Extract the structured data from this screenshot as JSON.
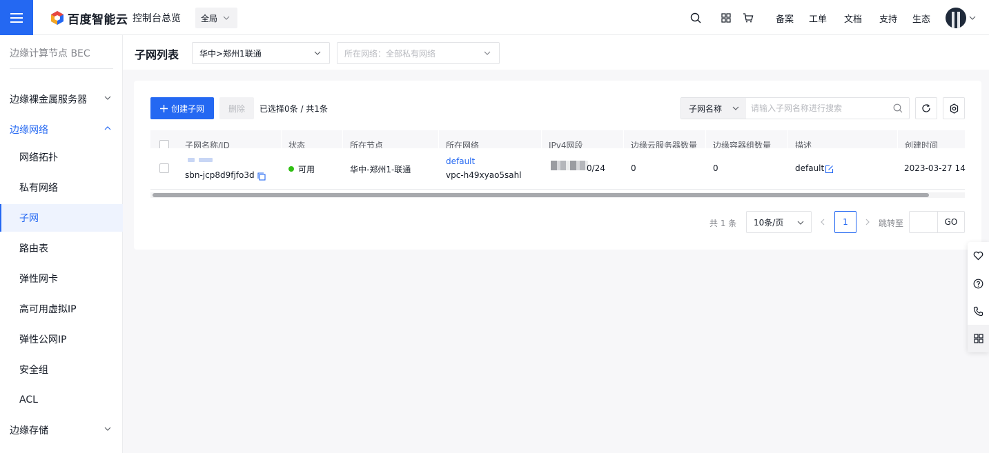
{
  "topbar": {
    "brand": "百度智能云",
    "console_title": "控制台总览",
    "region": "全局",
    "links": [
      "备案",
      "工单",
      "文档",
      "支持",
      "生态"
    ],
    "icons": [
      "search-icon",
      "apps-grid-icon",
      "cart-icon"
    ]
  },
  "sidebar": {
    "header": "边缘计算节点 BEC",
    "groups": [
      {
        "label": "边缘裸金属服务器"
      },
      {
        "label": "边缘网络"
      },
      {
        "label": "边缘存储"
      }
    ],
    "network_items": [
      "网络拓扑",
      "私有网络",
      "子网",
      "路由表",
      "弹性网卡",
      "高可用虚拟IP",
      "弹性公网IP",
      "安全组",
      "ACL"
    ]
  },
  "page": {
    "title": "子网列表",
    "node_select": "华中>郑州1联通",
    "network_select_placeholder": "所在网络：全部私有网络"
  },
  "toolbar": {
    "create_label": "创建子网",
    "delete_label": "删除",
    "selection_info": "已选择0条 / 共1条",
    "search_field": "子网名称",
    "search_placeholder": "请输入子网名称进行搜索"
  },
  "table": {
    "columns": [
      "子网名称/ID",
      "状态",
      "所在节点",
      "所在网络",
      "IPv4网段",
      "边缘云服务器数量",
      "边缘容器组数量",
      "描述",
      "创建时间"
    ],
    "rows": [
      {
        "subnet_id": "sbn-jcp8d9fjfo3d",
        "status": "可用",
        "node": "华中-郑州1-联通",
        "network_name": "default",
        "network_id": "vpc-h49xyao5sahl",
        "ipv4_suffix": "0/24",
        "server_count": "0",
        "container_count": "0",
        "description": "default",
        "created": "2023-03-27 14"
      }
    ]
  },
  "pagination": {
    "total": "共 1 条",
    "page_size": "10条/页",
    "current_page": "1",
    "jump_label": "跳转至",
    "go_label": "GO"
  },
  "colors": {
    "primary": "#2468f2",
    "status_ok": "#30bf13",
    "page_bg": "#f7f7f9"
  }
}
